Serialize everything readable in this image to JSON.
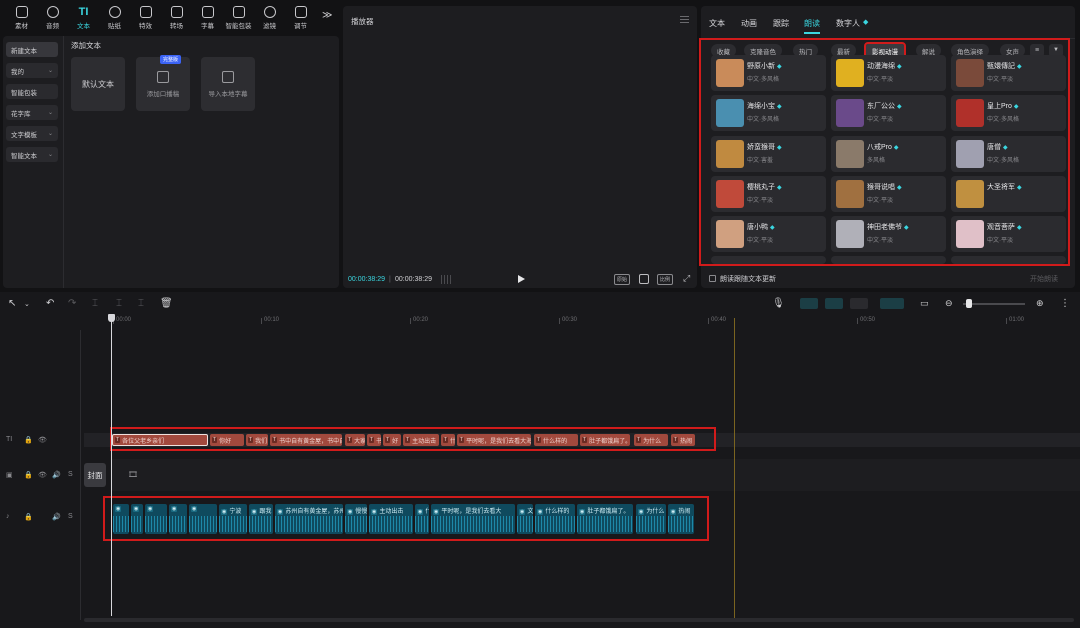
{
  "toolbar": {
    "tools": [
      "素材",
      "音频",
      "文本",
      "贴纸",
      "特效",
      "转场",
      "字幕",
      "智能包装",
      "滤镜",
      "调节"
    ],
    "active_tool": "文本",
    "more": "≫"
  },
  "sidebar": {
    "items": [
      {
        "label": "新建文本",
        "chevron": ""
      },
      {
        "label": "我的",
        "chevron": "⌄"
      },
      {
        "label": "智能包装",
        "chevron": ""
      },
      {
        "label": "花字库",
        "chevron": "⌄"
      },
      {
        "label": "文字模板",
        "chevron": "⌄"
      },
      {
        "label": "智能文本",
        "chevron": "⌄"
      }
    ]
  },
  "text_panel": {
    "title": "添加文本",
    "cards": [
      {
        "label": "默认文本"
      },
      {
        "label": "添加口播稿",
        "badge": "完整版"
      },
      {
        "label": "导入本地字幕"
      }
    ]
  },
  "player": {
    "title": "播放器",
    "time_current": "00:00:38:29",
    "time_total": "00:00:38:29",
    "btn_quality": "原始",
    "btn_ratio": "比例"
  },
  "right_panel": {
    "tabs": [
      "文本",
      "动画",
      "跟踪",
      "朗读",
      "数字人"
    ],
    "active_tab": "朗读",
    "chips": [
      "收藏",
      "克隆音色",
      "热门",
      "最新",
      "影视动漫",
      "解说",
      "角色演绎",
      "女声"
    ],
    "active_chip": "影视动漫",
    "voices": [
      {
        "name": "野原小新",
        "tag": "中文·多风格"
      },
      {
        "name": "动漫海绵",
        "tag": "中文·平淡"
      },
      {
        "name": "甄嬛傳記",
        "tag": "中文·平淡"
      },
      {
        "name": "海绵小宝",
        "tag": "中文·多风格"
      },
      {
        "name": "东厂公公",
        "tag": "中文·平淡"
      },
      {
        "name": "皇上Pro",
        "tag": "中文·多风格"
      },
      {
        "name": "娇蛮猴哥",
        "tag": "中文·害羞"
      },
      {
        "name": "八戒Pro",
        "tag": "多风格"
      },
      {
        "name": "唐僧",
        "tag": "中文·多风格"
      },
      {
        "name": "樱桃丸子",
        "tag": "中文·平淡"
      },
      {
        "name": "猴哥说唱",
        "tag": "中文·平淡"
      },
      {
        "name": "大圣将军",
        "tag": ""
      },
      {
        "name": "唐小鸭",
        "tag": "中文·平淡"
      },
      {
        "name": "神田老佛爷",
        "tag": "中文·平淡"
      },
      {
        "name": "观音菩萨",
        "tag": "中文·平淡"
      }
    ],
    "follow_label": "朗读跟随文本更新",
    "start_label": "开始朗读"
  },
  "timeline": {
    "ruler": [
      "00:00",
      "00:10",
      "00:20",
      "00:30",
      "00:40",
      "00:50",
      "01:00"
    ],
    "cover_label": "封面",
    "text_segments": [
      "各位父老乡亲们",
      "你好",
      "我们",
      "书中自有黄金屋，书中自有颜如玉",
      "大家",
      "书中自有黄金屋，书中",
      "好",
      "主动出击",
      "什么",
      "平时呢，是我们去看大海。",
      "什么样的",
      "肚子都饿扁了。",
      "为什么",
      "热闹"
    ],
    "audio_segments": [
      "",
      "",
      "",
      "",
      "宁波",
      "跟我",
      "苏州自有黄金屋，苏州",
      "慢慢",
      "主动出击",
      "什么",
      "平时呢，是我们去看大",
      "文本",
      "什么样的",
      "肚子都饿扁了。",
      "为什么",
      "热闹"
    ]
  }
}
